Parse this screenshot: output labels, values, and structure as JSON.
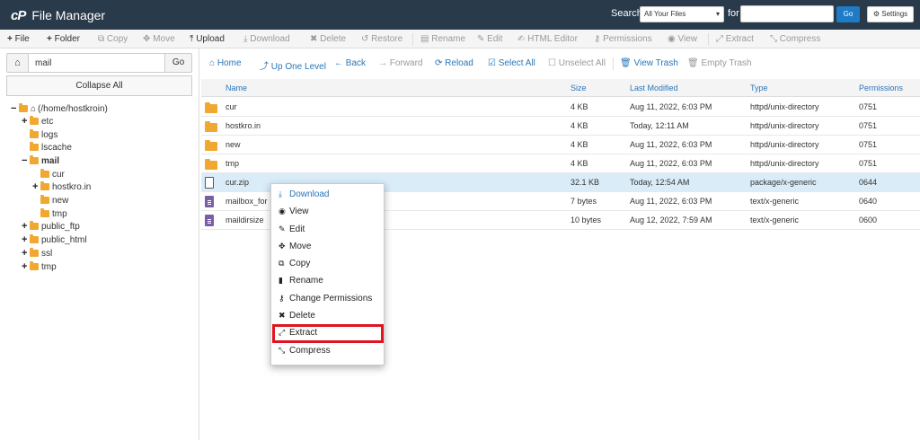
{
  "header": {
    "title": "File Manager",
    "logo_text": "cP",
    "search_label": "Search",
    "search_scope": "All Your Files",
    "for_label": "for",
    "search_value": "",
    "go_label": "Go",
    "settings_label": "Settings",
    "bg_color": "#293a4a"
  },
  "toolbar": [
    {
      "label": "File",
      "icon": "plus-icon",
      "enabled": true
    },
    {
      "label": "Folder",
      "icon": "plus-icon",
      "enabled": true
    },
    {
      "label": "Copy",
      "icon": "copy-icon",
      "enabled": false
    },
    {
      "label": "Move",
      "icon": "move-icon",
      "enabled": false
    },
    {
      "label": "Upload",
      "icon": "upload-icon",
      "enabled": true
    },
    {
      "label": "Download",
      "icon": "download-icon",
      "enabled": false
    },
    {
      "label": "Delete",
      "icon": "delete-icon",
      "enabled": false
    },
    {
      "label": "Restore",
      "icon": "restore-icon",
      "enabled": false
    },
    {
      "label": "Rename",
      "icon": "rename-icon",
      "enabled": false
    },
    {
      "label": "Edit",
      "icon": "pencil-icon",
      "enabled": false
    },
    {
      "label": "HTML Editor",
      "icon": "html-editor-icon",
      "enabled": false
    },
    {
      "label": "Permissions",
      "icon": "key-icon",
      "enabled": false
    },
    {
      "label": "View",
      "icon": "eye-icon",
      "enabled": false
    },
    {
      "label": "Extract",
      "icon": "extract-icon",
      "enabled": false
    },
    {
      "label": "Compress",
      "icon": "compress-icon",
      "enabled": false
    }
  ],
  "left": {
    "path_value": "mail",
    "go_label": "Go",
    "collapse_label": "Collapse All",
    "tree": [
      {
        "label": "(/home/hostkroin)",
        "toggle": "−",
        "type": "home"
      },
      {
        "label": "etc",
        "toggle": "+",
        "type": "folder"
      },
      {
        "label": "logs",
        "toggle": "",
        "type": "folder"
      },
      {
        "label": "lscache",
        "toggle": "",
        "type": "folder"
      },
      {
        "label": "mail",
        "toggle": "−",
        "type": "folder",
        "bold": true
      },
      {
        "label": "cur",
        "toggle": "",
        "type": "folder"
      },
      {
        "label": "hostkro.in",
        "toggle": "+",
        "type": "folder"
      },
      {
        "label": "new",
        "toggle": "",
        "type": "folder"
      },
      {
        "label": "tmp",
        "toggle": "",
        "type": "folder"
      },
      {
        "label": "public_ftp",
        "toggle": "+",
        "type": "folder"
      },
      {
        "label": "public_html",
        "toggle": "+",
        "type": "folder"
      },
      {
        "label": "ssl",
        "toggle": "+",
        "type": "folder"
      },
      {
        "label": "tmp",
        "toggle": "+",
        "type": "folder"
      }
    ]
  },
  "nav": [
    {
      "label": "Home",
      "icon": "home-icon",
      "enabled": true
    },
    {
      "label": "Up One Level",
      "icon": "up-level-icon",
      "enabled": true
    },
    {
      "label": "Back",
      "icon": "arrow-left-icon",
      "enabled": true
    },
    {
      "label": "Forward",
      "icon": "arrow-right-icon",
      "enabled": false
    },
    {
      "label": "Reload",
      "icon": "reload-icon",
      "enabled": true
    },
    {
      "label": "Select All",
      "icon": "checkbox-checked-icon",
      "enabled": true
    },
    {
      "label": "Unselect All",
      "icon": "checkbox-empty-icon",
      "enabled": false
    },
    {
      "label": "View Trash",
      "icon": "trash-icon",
      "enabled": true
    },
    {
      "label": "Empty Trash",
      "icon": "trash-icon",
      "enabled": false
    }
  ],
  "columns": [
    "Name",
    "Size",
    "Last Modified",
    "Type",
    "Permissions"
  ],
  "files": [
    {
      "name": "cur",
      "size": "4 KB",
      "modified": "Aug 11, 2022, 6:03 PM",
      "type": "httpd/unix-directory",
      "perms": "0751",
      "kind": "folder"
    },
    {
      "name": "hostkro.in",
      "size": "4 KB",
      "modified": "Today, 12:11 AM",
      "type": "httpd/unix-directory",
      "perms": "0751",
      "kind": "folder"
    },
    {
      "name": "new",
      "size": "4 KB",
      "modified": "Aug 11, 2022, 6:03 PM",
      "type": "httpd/unix-directory",
      "perms": "0751",
      "kind": "folder"
    },
    {
      "name": "tmp",
      "size": "4 KB",
      "modified": "Aug 11, 2022, 6:03 PM",
      "type": "httpd/unix-directory",
      "perms": "0751",
      "kind": "folder"
    },
    {
      "name": "cur.zip",
      "size": "32.1 KB",
      "modified": "Today, 12:54 AM",
      "type": "package/x-generic",
      "perms": "0644",
      "kind": "zip",
      "selected": true
    },
    {
      "name": "mailbox_for",
      "size": "7 bytes",
      "modified": "Aug 11, 2022, 6:03 PM",
      "type": "text/x-generic",
      "perms": "0640",
      "kind": "text"
    },
    {
      "name": "maildirsize",
      "size": "10 bytes",
      "modified": "Aug 12, 2022, 7:59 AM",
      "type": "text/x-generic",
      "perms": "0600",
      "kind": "text"
    }
  ],
  "context_menu": [
    {
      "label": "Download",
      "icon": "download-icon"
    },
    {
      "label": "View",
      "icon": "eye-icon"
    },
    {
      "label": "Edit",
      "icon": "pencil-icon"
    },
    {
      "label": "Move",
      "icon": "move-icon"
    },
    {
      "label": "Copy",
      "icon": "copy-icon"
    },
    {
      "label": "Rename",
      "icon": "rename-icon"
    },
    {
      "label": "Change Permissions",
      "icon": "key-icon"
    },
    {
      "label": "Delete",
      "icon": "delete-icon"
    },
    {
      "label": "Extract",
      "icon": "extract-icon",
      "highlighted": true
    },
    {
      "label": "Compress",
      "icon": "compress-icon"
    }
  ],
  "colors": {
    "link": "#2a76b8",
    "highlight": "#e0151f",
    "selected_row": "#d9ecf8",
    "folder": "#f0a830"
  }
}
